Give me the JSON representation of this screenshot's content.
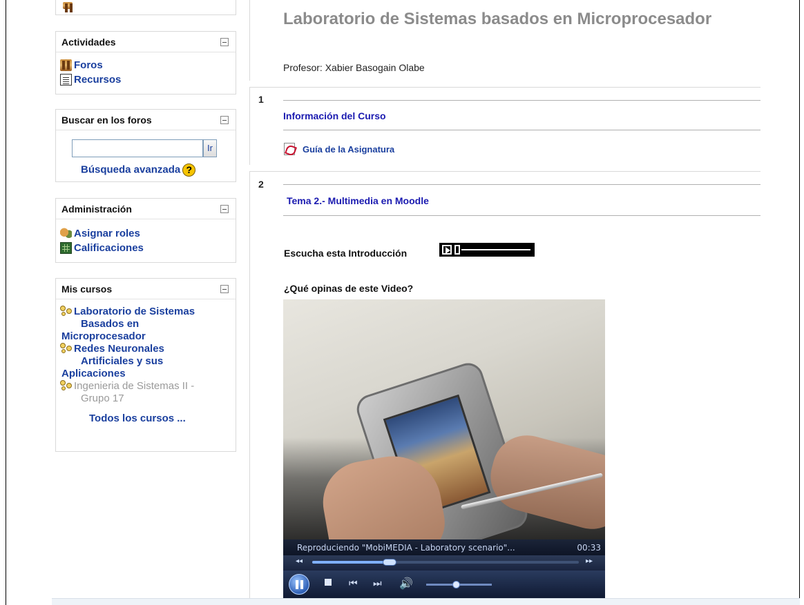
{
  "sidebar": {
    "activities": {
      "title": "Actividades",
      "items": [
        {
          "label": "Foros",
          "icon": "forum-icon"
        },
        {
          "label": "Recursos",
          "icon": "resource-icon"
        }
      ]
    },
    "forum_search": {
      "title": "Buscar en los foros",
      "input_value": "",
      "button_label": "Ir",
      "advanced_link": "Búsqueda avanzada",
      "help_glyph": "?"
    },
    "administration": {
      "title": "Administración",
      "items": [
        {
          "label": "Asignar roles",
          "icon": "assign-roles-icon"
        },
        {
          "label": "Calificaciones",
          "icon": "grades-icon"
        }
      ]
    },
    "my_courses": {
      "title": "Mis cursos",
      "courses": [
        {
          "line1": "Laboratorio de Sistemas",
          "line2": "Basados en",
          "line3": "Microprocesador"
        },
        {
          "line1": "Redes Neuronales",
          "line2": "Artificiales y sus",
          "line3": "Aplicaciones"
        },
        {
          "line1": "Ingenieria de Sistemas II -",
          "line2": "Grupo 17"
        }
      ],
      "all_courses": "Todos los cursos ..."
    }
  },
  "main": {
    "course_title": "Laboratorio de Sistemas basados en Microprocesador",
    "teacher": "Profesor: Xabier Basogain Olabe",
    "section1": {
      "number": "1",
      "heading": "Información del Curso",
      "resource": "Guía de la Asignatura"
    },
    "section2": {
      "number": "2",
      "heading": "Tema 2.-  Multimedia en Moodle",
      "audio_label": "Escucha esta Introducción",
      "video_question": "¿Qué opinas de este Video?",
      "video": {
        "status": "Reproduciendo \"MobiMEDIA - Laboratory scenario\"...",
        "time": "00:33",
        "progress": 0.29,
        "volume": 0.45
      }
    }
  },
  "colors": {
    "link": "#1a3f9e",
    "section_link": "#1a1ab0",
    "title_gray": "#8b8b8b"
  }
}
